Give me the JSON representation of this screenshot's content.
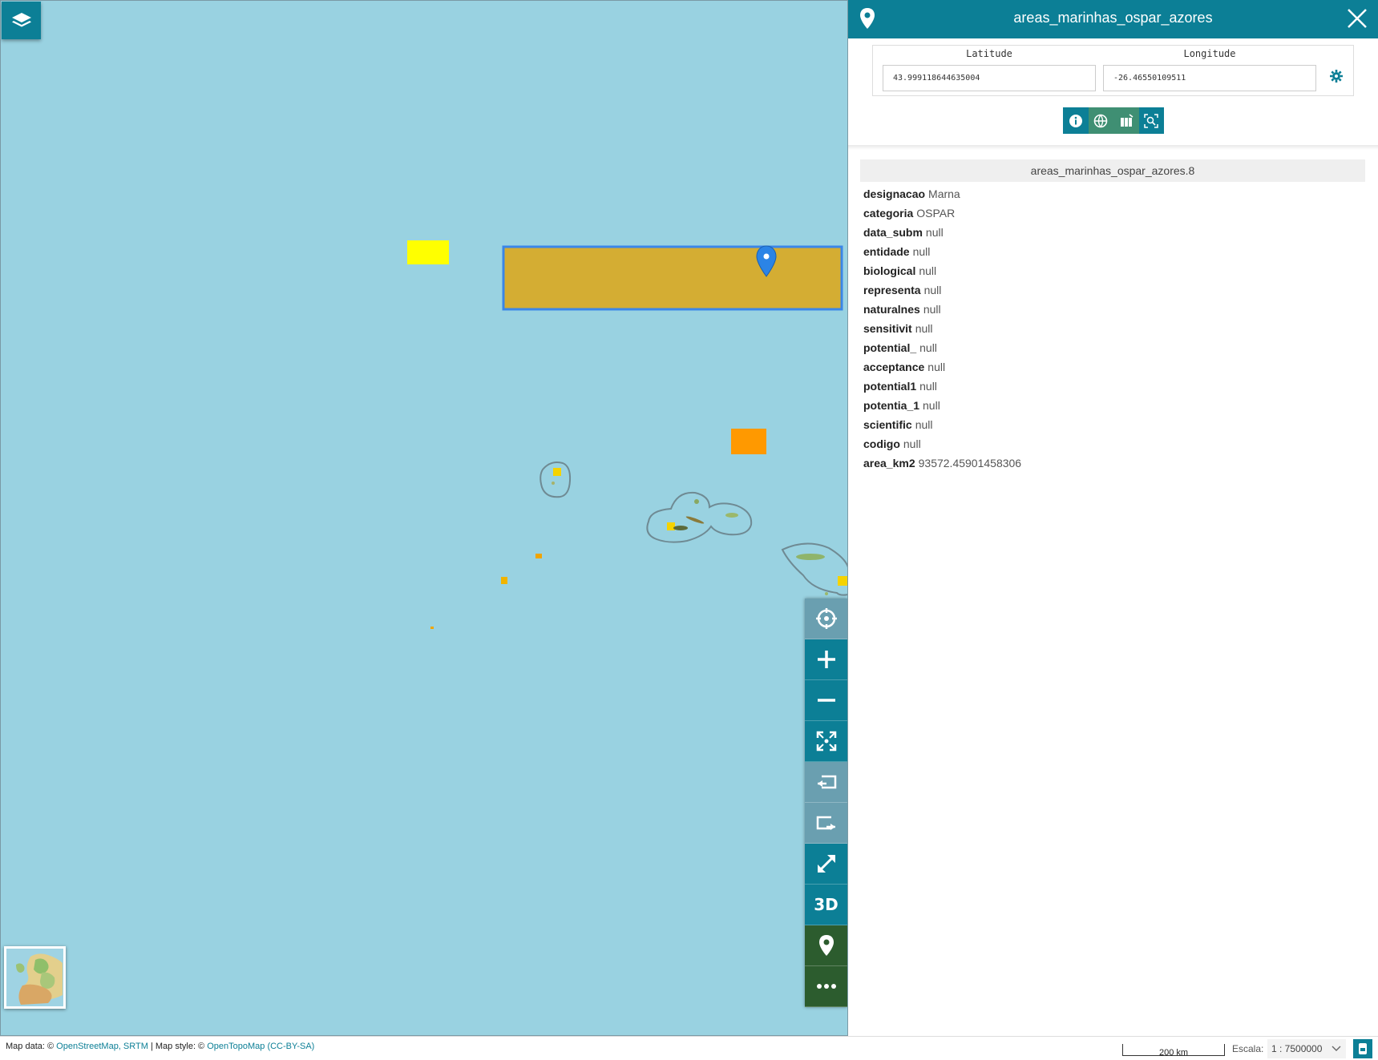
{
  "panel": {
    "title": "areas_marinhas_ospar_azores",
    "latitude_label": "Latitude",
    "longitude_label": "Longitude",
    "latitude_value": "43.999118644635004",
    "longitude_value": "-26.46550109511",
    "feature_id": "areas_marinhas_ospar_azores.8",
    "attributes": [
      {
        "key": "designacao",
        "value": "Marna"
      },
      {
        "key": "categoria",
        "value": "OSPAR"
      },
      {
        "key": "data_subm",
        "value": "null"
      },
      {
        "key": "entidade",
        "value": "null"
      },
      {
        "key": "biological",
        "value": "null"
      },
      {
        "key": "representa",
        "value": "null"
      },
      {
        "key": "naturalnes",
        "value": "null"
      },
      {
        "key": "sensitivit",
        "value": "null"
      },
      {
        "key": "potential_",
        "value": "null"
      },
      {
        "key": "acceptance",
        "value": "null"
      },
      {
        "key": "potential1",
        "value": "null"
      },
      {
        "key": "potentia_1",
        "value": "null"
      },
      {
        "key": "scientific",
        "value": "null"
      },
      {
        "key": "codigo",
        "value": "null"
      },
      {
        "key": "area_km2",
        "value": "93572.45901458306"
      }
    ]
  },
  "toolbar": {
    "three_d_label": "3D"
  },
  "footer": {
    "attribution_prefix": "Map data: ©",
    "attribution_osm": "OpenStreetMap, SRTM",
    "attribution_mid": "| Map style: ©",
    "attribution_otm": "OpenTopoMap",
    "attribution_license": "(CC-BY-SA)",
    "scale_bar_label": "200 km",
    "scale_label": "Escala:",
    "scale_value": "1 : 7500000"
  },
  "colors": {
    "sea": "#99d2e1",
    "accent": "#0c7f96",
    "selected_area": "#d4ad33",
    "selected_outline": "#3a86e8",
    "yellow_area": "#ffff00",
    "orange_area": "#ff9900"
  },
  "icons": [
    "layers-icon",
    "locate-icon",
    "zoom-in-icon",
    "zoom-out-icon",
    "fit-extent-icon",
    "previous-extent-icon",
    "next-extent-icon",
    "fullscreen-icon",
    "pin-icon",
    "more-icon",
    "info-icon",
    "globe-icon",
    "columns-icon",
    "zoom-feature-icon",
    "gear-icon",
    "close-icon"
  ]
}
